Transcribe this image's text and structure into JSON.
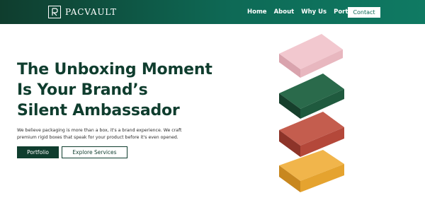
{
  "nav": {
    "logo_text": "PACVAULT",
    "links": [
      "Home",
      "About",
      "Why Us",
      "Portfolio"
    ],
    "contact_label": "Contact"
  },
  "hero": {
    "title_lines": [
      "The Unboxing Moment",
      "Is Your Brand’s",
      "Silent Ambassador"
    ],
    "description_lines": [
      "We believe packaging is more than a box, it's a brand experience. We craft",
      "premium rigid boxes that speak for your product before it's even opened."
    ],
    "primary_button": "Portfolio",
    "secondary_button": "Explore Services"
  },
  "colors": {
    "brand_dark": "#0f3d2e",
    "brand_accent": "#0e6a56",
    "box_pink": "#e8b7bf",
    "box_green": "#1f5a3e",
    "box_red": "#b4483a",
    "box_yellow": "#e5a32f"
  },
  "illustration": {
    "icon": "stacked-boxes-illustration",
    "boxes": [
      "pink-box",
      "green-box",
      "red-box",
      "yellow-box"
    ]
  }
}
